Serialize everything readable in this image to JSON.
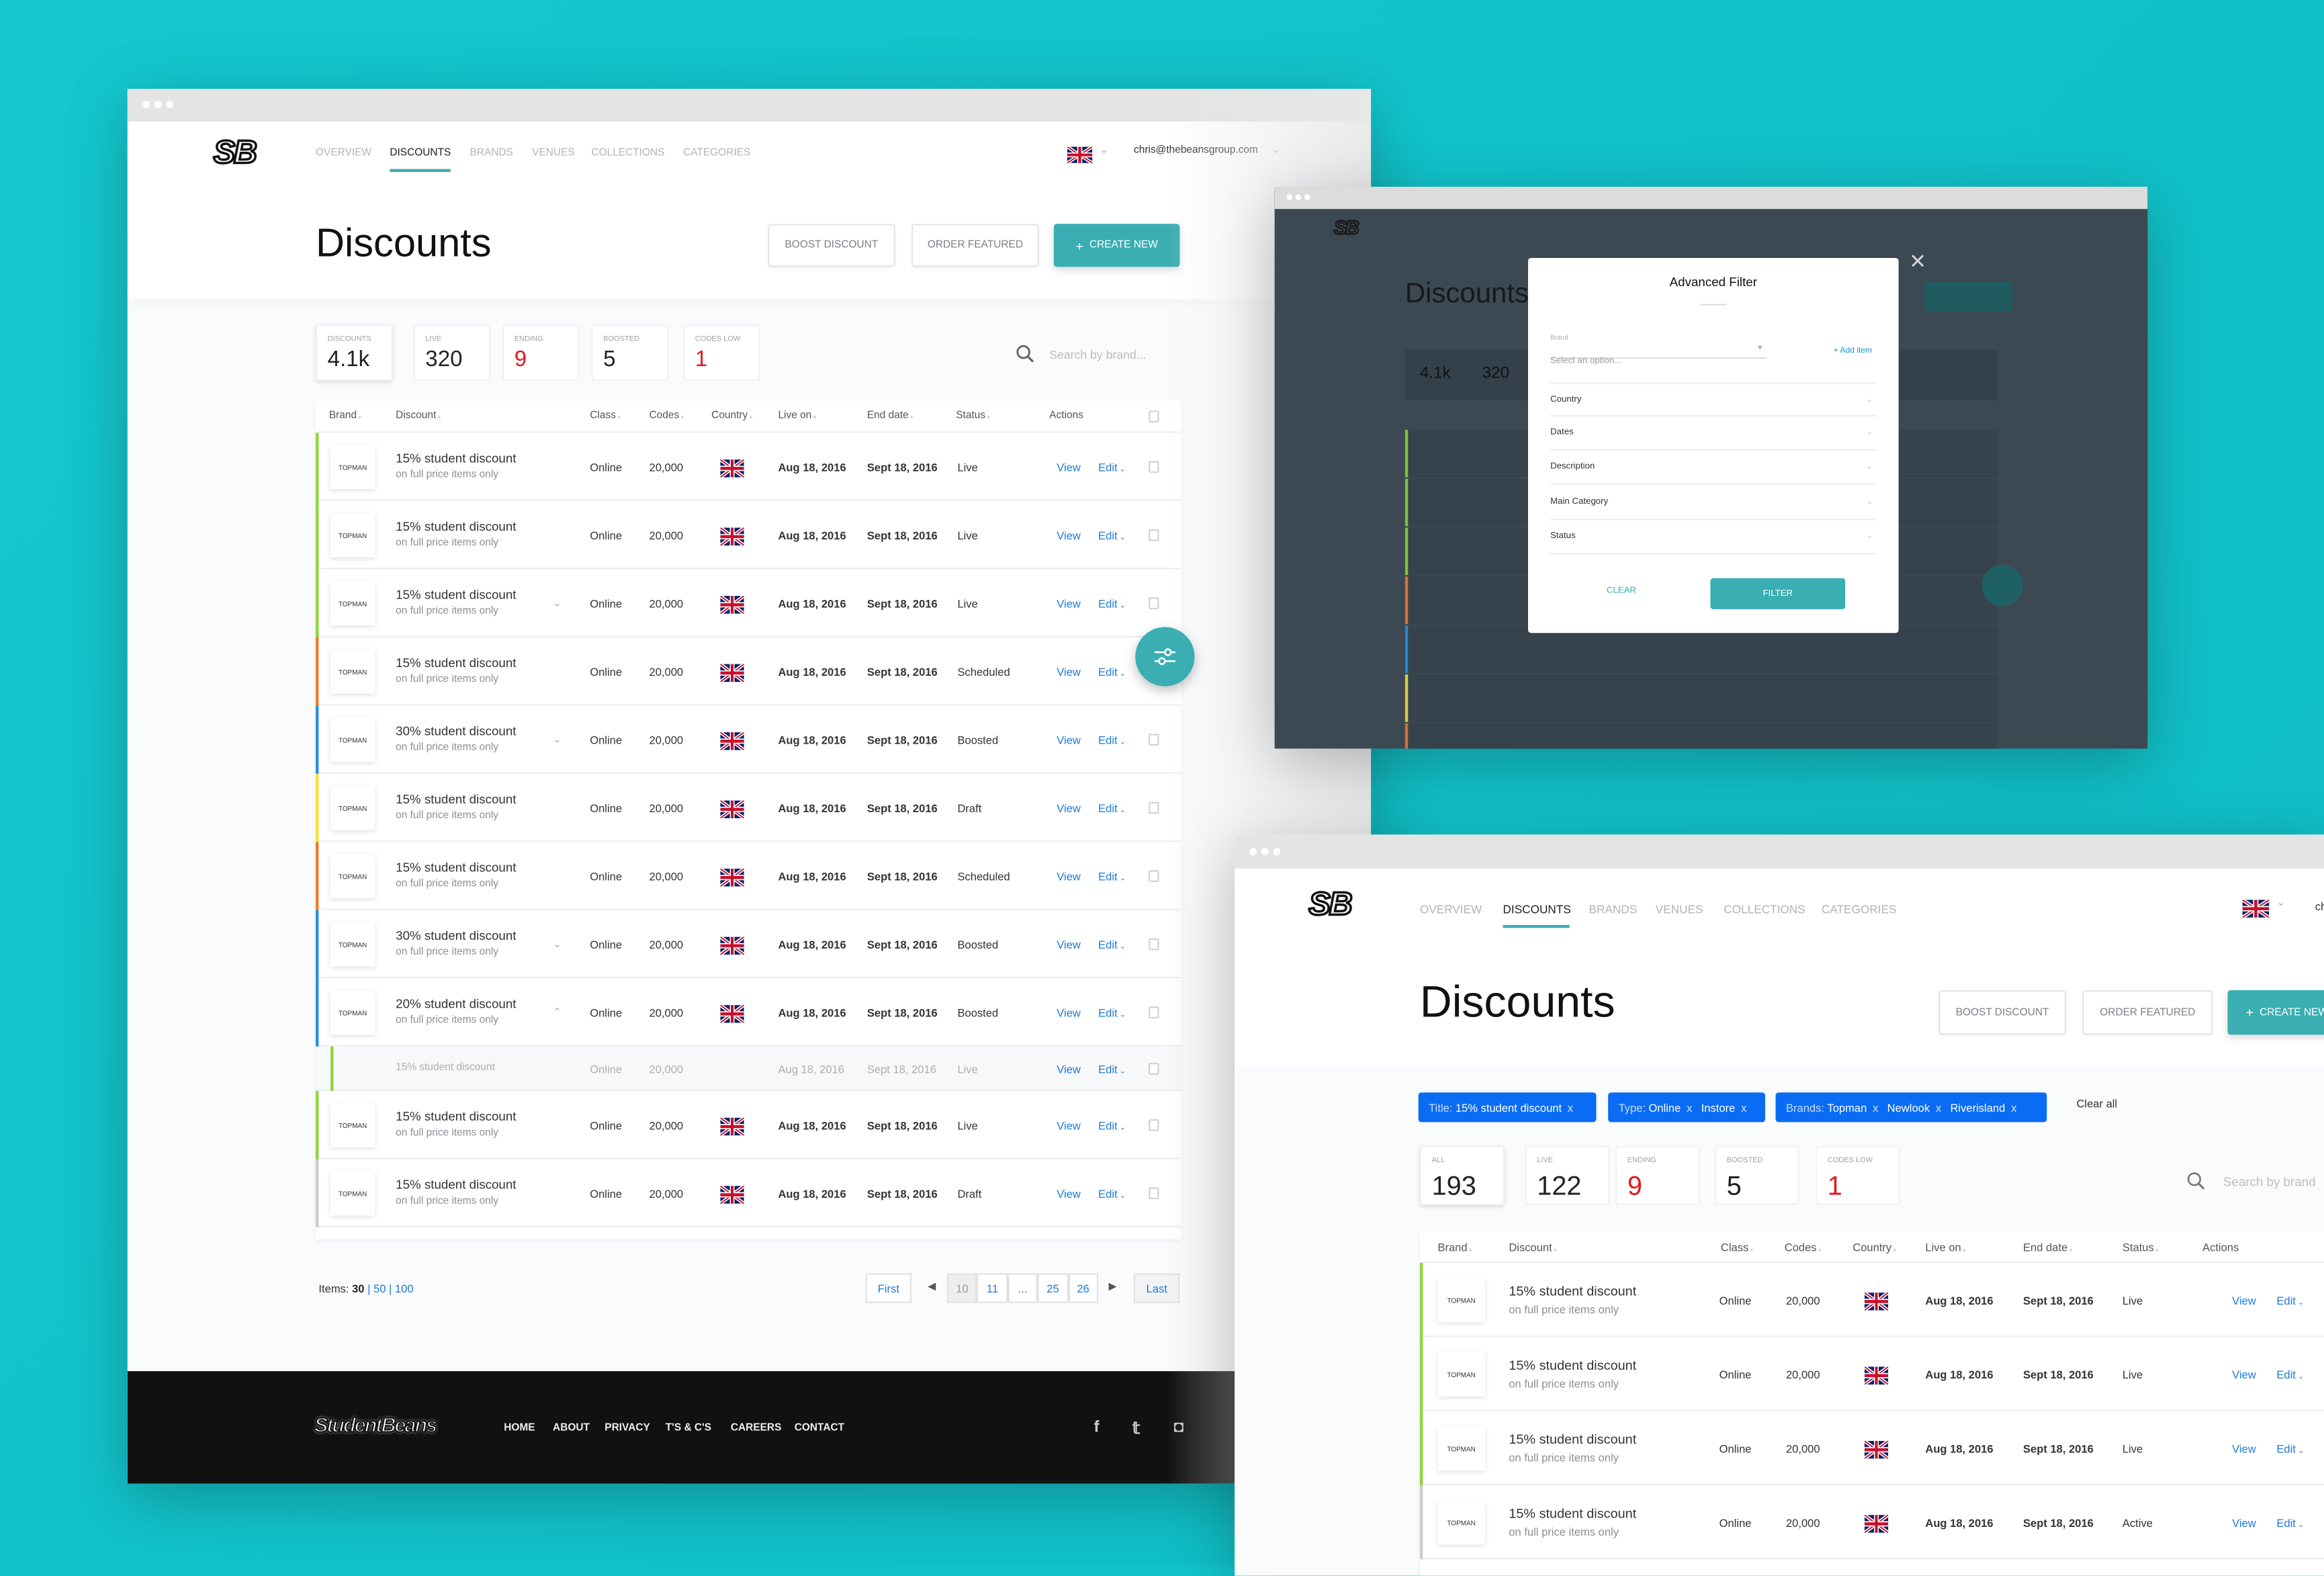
{
  "colors": {
    "background": "#12c4ca",
    "accent": "#3aaeb2",
    "link": "#1e7ad8",
    "chip": "#0a6cf5",
    "alert": "#e0191f",
    "status_live": "#8fd43a",
    "status_scheduled": "#f07a2a",
    "status_boosted": "#2a8ee0",
    "status_draft": "#f5e23a",
    "status_other": "#cccccc"
  },
  "logo": "SB",
  "nav": [
    "OVERVIEW",
    "DISCOUNTS",
    "BRANDS",
    "VENUES",
    "COLLECTIONS",
    "CATEGORIES"
  ],
  "user_email": "chris@thebeansgroup.com",
  "page_title": "Discounts",
  "buttons": {
    "boost": "BOOST DISCOUNT",
    "order": "ORDER FEATURED",
    "create": "CREATE NEW",
    "create_icon": "plus-icon"
  },
  "search_placeholder": "Search by brand...",
  "stats": [
    {
      "label": "DISCOUNTS",
      "value": "4.1k"
    },
    {
      "label": "LIVE",
      "value": "320"
    },
    {
      "label": "ENDING",
      "value": "9",
      "alert": true
    },
    {
      "label": "BOOSTED",
      "value": "5"
    },
    {
      "label": "CODES LOW",
      "value": "1",
      "alert": true
    }
  ],
  "columns": [
    "Brand",
    "Discount",
    "Class",
    "Codes",
    "Country",
    "Live on",
    "End date",
    "Status",
    "Actions"
  ],
  "actions": {
    "view": "View",
    "edit": "Edit"
  },
  "rows": [
    {
      "brand": "TOPMAN",
      "title": "15% student discount",
      "subtitle": "on full price items only",
      "class": "Online",
      "codes": "20,000",
      "country": "uk-flag",
      "live_on": "Aug 18, 2016",
      "end_date": "Sept 18, 2016",
      "status": "Live",
      "bar": "status_live"
    },
    {
      "brand": "TOPMAN",
      "title": "15% student discount",
      "subtitle": "on full price items only",
      "class": "Online",
      "codes": "20,000",
      "country": "uk-flag",
      "live_on": "Aug 18, 2016",
      "end_date": "Sept 18, 2016",
      "status": "Live",
      "bar": "status_live"
    },
    {
      "brand": "TOPMAN",
      "title": "15% student discount",
      "subtitle": "on full price items only",
      "class": "Online",
      "codes": "20,000",
      "country": "uk-flag",
      "live_on": "Aug 18, 2016",
      "end_date": "Sept 18, 2016",
      "status": "Live",
      "bar": "status_live",
      "expand": "down"
    },
    {
      "brand": "TOPMAN",
      "title": "15% student discount",
      "subtitle": "on full price items only",
      "class": "Online",
      "codes": "20,000",
      "country": "uk-flag",
      "live_on": "Aug 18, 2016",
      "end_date": "Sept 18, 2016",
      "status": "Scheduled",
      "bar": "status_scheduled"
    },
    {
      "brand": "TOPMAN",
      "title": "30% student discount",
      "subtitle": "on full price items only",
      "class": "Online",
      "codes": "20,000",
      "country": "uk-flag",
      "live_on": "Aug 18, 2016",
      "end_date": "Sept 18, 2016",
      "status": "Boosted",
      "bar": "status_boosted",
      "expand": "down"
    },
    {
      "brand": "TOPMAN",
      "title": "15% student discount",
      "subtitle": "on full price items only",
      "class": "Online",
      "codes": "20,000",
      "country": "uk-flag",
      "live_on": "Aug 18, 2016",
      "end_date": "Sept 18, 2016",
      "status": "Draft",
      "bar": "status_draft"
    },
    {
      "brand": "TOPMAN",
      "title": "15% student discount",
      "subtitle": "on full price items only",
      "class": "Online",
      "codes": "20,000",
      "country": "uk-flag",
      "live_on": "Aug 18, 2016",
      "end_date": "Sept 18, 2016",
      "status": "Scheduled",
      "bar": "status_scheduled"
    },
    {
      "brand": "TOPMAN",
      "title": "30% student discount",
      "subtitle": "on full price items only",
      "class": "Online",
      "codes": "20,000",
      "country": "uk-flag",
      "live_on": "Aug 18, 2016",
      "end_date": "Sept 18, 2016",
      "status": "Boosted",
      "bar": "status_boosted",
      "expand": "down"
    },
    {
      "brand": "TOPMAN",
      "title": "20% student discount",
      "subtitle": "on full price items only",
      "class": "Online",
      "codes": "20,000",
      "country": "uk-flag",
      "live_on": "Aug 18, 2016",
      "end_date": "Sept 18, 2016",
      "status": "Boosted",
      "bar": "status_boosted",
      "expand": "up"
    },
    {
      "sub": true,
      "title": "15% student discount",
      "class": "Online",
      "codes": "20,000",
      "live_on": "Aug 18, 2016",
      "end_date": "Sept 18, 2016",
      "status": "Live",
      "bar": "status_live"
    },
    {
      "brand": "TOPMAN",
      "title": "15% student discount",
      "subtitle": "on full price items only",
      "class": "Online",
      "codes": "20,000",
      "country": "uk-flag",
      "live_on": "Aug 18, 2016",
      "end_date": "Sept 18, 2016",
      "status": "Live",
      "bar": "status_live"
    },
    {
      "brand": "TOPMAN",
      "title": "15% student discount",
      "subtitle": "on full price items only",
      "class": "Online",
      "codes": "20,000",
      "country": "uk-flag",
      "live_on": "Aug 18, 2016",
      "end_date": "Sept 18, 2016",
      "status": "Draft",
      "bar": "status_other"
    }
  ],
  "pagination": {
    "items_label": "Items:",
    "sizes": [
      "30",
      "50",
      "100"
    ],
    "first": "First",
    "last": "Last",
    "pages": [
      "10",
      "11",
      "...",
      "25",
      "26"
    ],
    "current": "10"
  },
  "footer": {
    "logo": "StudentBeans",
    "links": [
      "HOME",
      "ABOUT",
      "PRIVACY",
      "T'S & C'S",
      "CAREERS",
      "CONTACT"
    ],
    "social": [
      "facebook-icon",
      "twitter-icon",
      "instagram-icon"
    ]
  },
  "modal": {
    "title": "Advanced Filter",
    "brand_label": "Brand",
    "brand_placeholder": "Select an option...",
    "add_item": "+ Add item",
    "sections": [
      "Country",
      "Dates",
      "Description",
      "Main Category",
      "Status"
    ],
    "clear": "CLEAR",
    "filter": "FILTER"
  },
  "window3": {
    "user_email_visible": "ch",
    "chips": [
      {
        "key": "Title:",
        "values": [
          "15% student discount"
        ]
      },
      {
        "key": "Type:",
        "values": [
          "Online",
          "Instore"
        ]
      },
      {
        "key": "Brands:",
        "values": [
          "Topman",
          "Newlook",
          "Riverisland"
        ]
      }
    ],
    "chip_remove": "x",
    "clear_all": "Clear all",
    "search_placeholder": "Search by brand",
    "stats": [
      {
        "label": "ALL",
        "value": "193"
      },
      {
        "label": "LIVE",
        "value": "122"
      },
      {
        "label": "ENDING",
        "value": "9",
        "alert": true
      },
      {
        "label": "BOOSTED",
        "value": "5"
      },
      {
        "label": "CODES LOW",
        "value": "1",
        "alert": true
      }
    ],
    "rows": [
      {
        "brand": "TOPMAN",
        "title": "15% student discount",
        "subtitle": "on full price items only",
        "class": "Online",
        "codes": "20,000",
        "country": "uk-flag",
        "live_on": "Aug 18, 2016",
        "end_date": "Sept 18, 2016",
        "status": "Live",
        "bar": "status_live"
      },
      {
        "brand": "TOPMAN",
        "title": "15% student discount",
        "subtitle": "on full price items only",
        "class": "Online",
        "codes": "20,000",
        "country": "uk-flag",
        "live_on": "Aug 18, 2016",
        "end_date": "Sept 18, 2016",
        "status": "Live",
        "bar": "status_live"
      },
      {
        "brand": "TOPMAN",
        "title": "15% student discount",
        "subtitle": "on full price items only",
        "class": "Online",
        "codes": "20,000",
        "country": "uk-flag",
        "live_on": "Aug 18, 2016",
        "end_date": "Sept 18, 2016",
        "status": "Live",
        "bar": "status_live"
      },
      {
        "brand": "TOPMAN",
        "title": "15% student discount",
        "subtitle": "on full price items only",
        "class": "Online",
        "codes": "20,000",
        "country": "uk-flag",
        "live_on": "Aug 18, 2016",
        "end_date": "Sept 18, 2016",
        "status": "Active",
        "bar": "status_other"
      }
    ]
  }
}
